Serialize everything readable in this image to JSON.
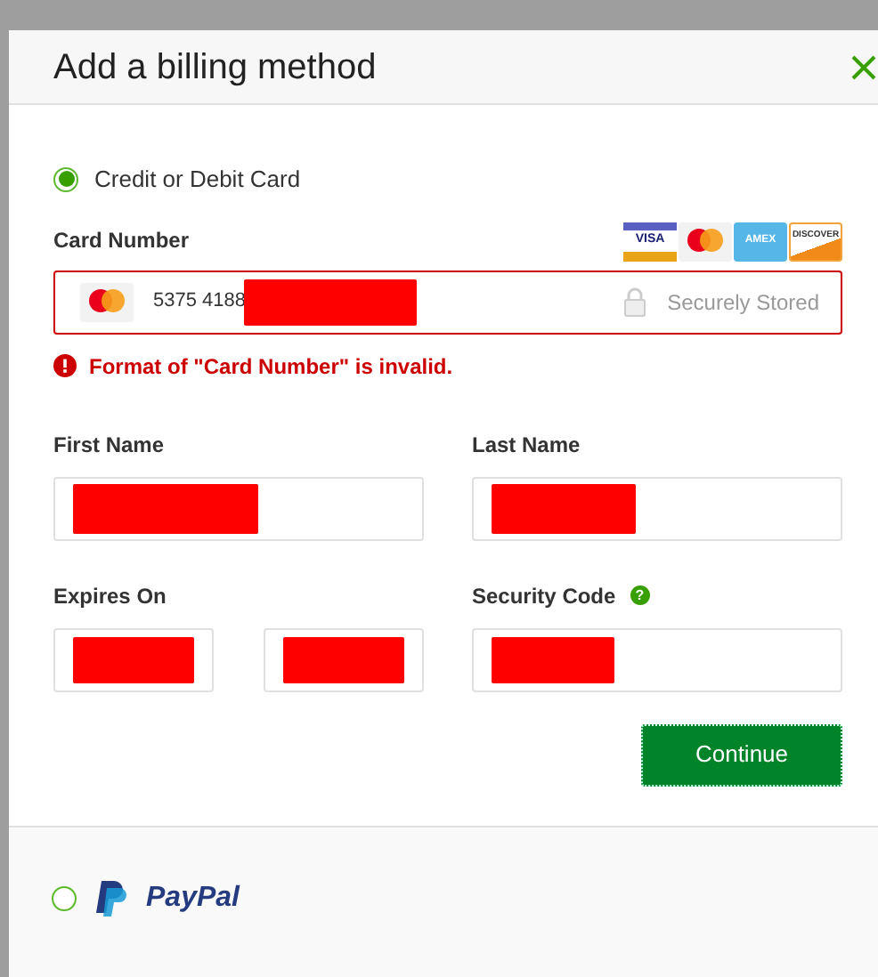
{
  "dialog": {
    "title": "Add a billing method"
  },
  "methods": [
    {
      "kind": "card",
      "label": "Credit or Debit Card",
      "selected": true
    },
    {
      "kind": "paypal",
      "label": "PayPal",
      "selected": false
    }
  ],
  "card_brands": [
    {
      "kind": "visa",
      "text": "VISA"
    },
    {
      "kind": "mastercard"
    },
    {
      "kind": "amex",
      "text": "AMEX"
    },
    {
      "kind": "discover",
      "text": "DISCOVER"
    }
  ],
  "card_number": {
    "label": "Card Number",
    "value": "5375 4188",
    "redacted": true,
    "invalid": true,
    "hint": "Securely Stored",
    "error": "Format of \"Card Number\" is invalid."
  },
  "fields": [
    {
      "label": "First Name",
      "redacted": true
    },
    {
      "label": "Last Name",
      "redacted": true
    }
  ],
  "expires": {
    "label": "Expires On",
    "parts": [
      {
        "redacted": true
      },
      {
        "redacted": true
      }
    ]
  },
  "security_code": {
    "label": "Security Code",
    "redacted": true,
    "help": "?"
  },
  "continue_button": "Continue"
}
